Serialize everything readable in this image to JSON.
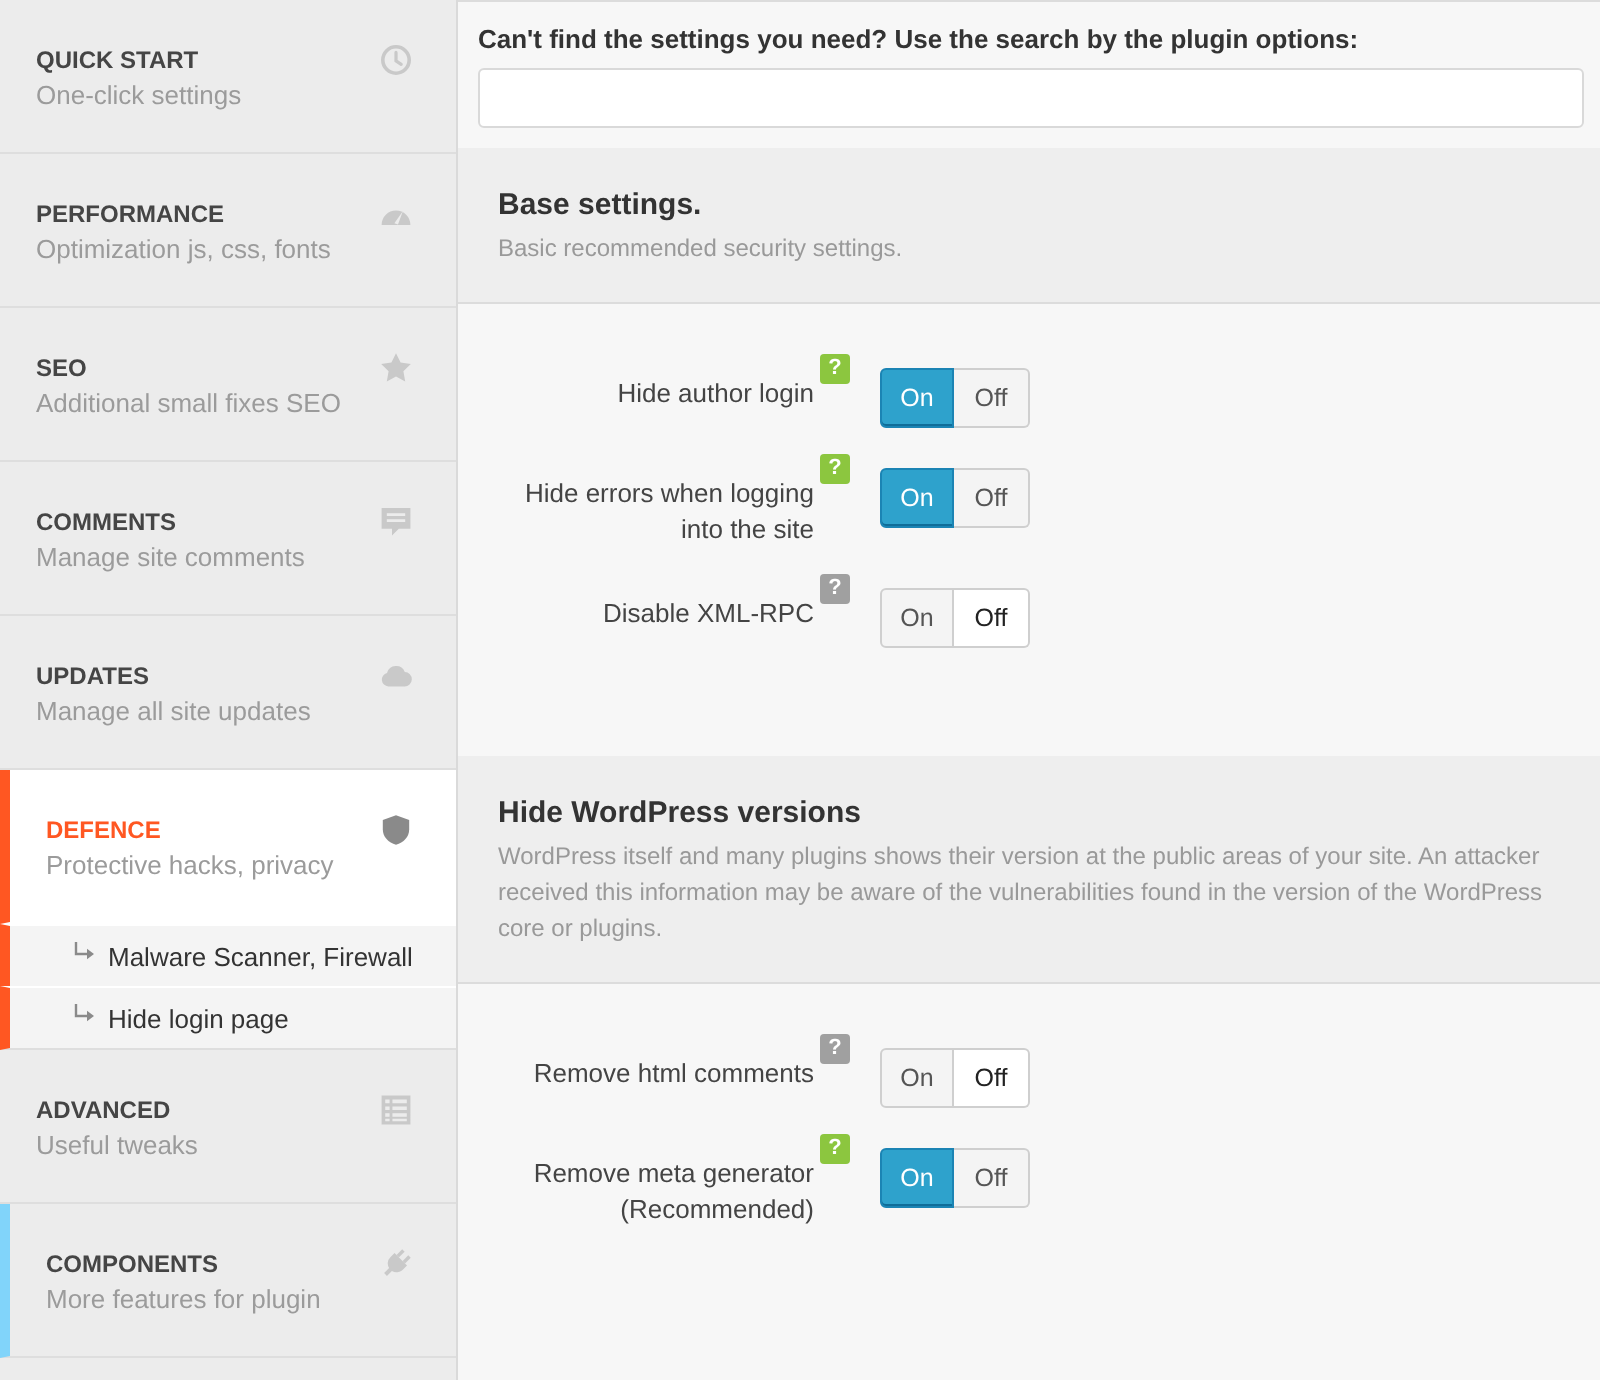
{
  "sidebar": {
    "items": [
      {
        "title": "QUICK START",
        "subtitle": "One-click settings",
        "selected": false,
        "highlighted": false
      },
      {
        "title": "PERFORMANCE",
        "subtitle": "Optimization js, css, fonts",
        "selected": false,
        "highlighted": false
      },
      {
        "title": "SEO",
        "subtitle": "Additional small fixes SEO",
        "selected": false,
        "highlighted": false
      },
      {
        "title": "COMMENTS",
        "subtitle": "Manage site comments",
        "selected": false,
        "highlighted": false
      },
      {
        "title": "UPDATES",
        "subtitle": "Manage all site updates",
        "selected": false,
        "highlighted": false
      },
      {
        "title": "DEFENCE",
        "subtitle": "Protective hacks, privacy",
        "selected": true,
        "highlighted": false,
        "children": [
          {
            "label": "Malware Scanner, Firewall",
            "selected": false
          },
          {
            "label": "Hide login page",
            "selected": false
          }
        ]
      },
      {
        "title": "ADVANCED",
        "subtitle": "Useful tweaks",
        "selected": false,
        "highlighted": false
      },
      {
        "title": "COMPONENTS",
        "subtitle": "More features for plugin",
        "selected": false,
        "highlighted": true
      }
    ]
  },
  "search": {
    "label": "Can't find the settings you need? Use the search by the plugin options:"
  },
  "sections": [
    {
      "title": "Base settings.",
      "description": "Basic recommended security settings.",
      "settings": [
        {
          "label": "Hide author login",
          "help": {
            "text": "?",
            "color": "#8cc63f"
          },
          "options": [
            {
              "label": "On",
              "selected": true
            },
            {
              "label": "Off",
              "selected": false
            }
          ]
        },
        {
          "label": "Hide errors when logging into the site",
          "help": {
            "text": "?",
            "color": "#8cc63f"
          },
          "options": [
            {
              "label": "On",
              "selected": true
            },
            {
              "label": "Off",
              "selected": false
            }
          ]
        },
        {
          "label": "Disable XML-RPC",
          "help": {
            "text": "?",
            "color": "#a0a0a0"
          },
          "options": [
            {
              "label": "On",
              "selected": false
            },
            {
              "label": "Off",
              "selected": true
            }
          ]
        }
      ]
    },
    {
      "title": "Hide WordPress versions",
      "description": "WordPress itself and many plugins shows their version at the public areas of your site. An attacker received this information may be aware of the vulnerabilities found in the version of the WordPress core or plugins.",
      "settings": [
        {
          "label": "Remove html comments",
          "help": {
            "text": "?",
            "color": "#a0a0a0"
          },
          "options": [
            {
              "label": "On",
              "selected": false
            },
            {
              "label": "Off",
              "selected": true
            }
          ]
        },
        {
          "label": "Remove meta generator (Recommended)",
          "help": {
            "text": "?",
            "color": "#8cc63f"
          },
          "options": [
            {
              "label": "On",
              "selected": true
            },
            {
              "label": "Off",
              "selected": false
            }
          ]
        }
      ]
    }
  ]
}
